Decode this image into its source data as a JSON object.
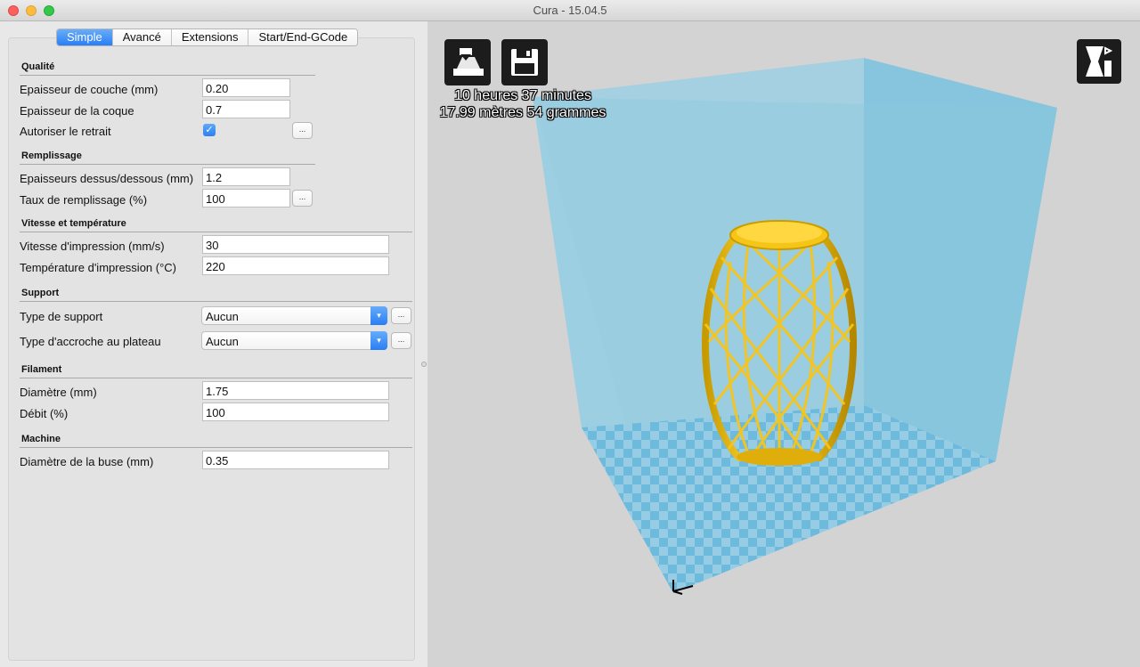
{
  "window": {
    "title": "Cura - 15.04.5"
  },
  "tabs": [
    {
      "label": "Simple",
      "active": true
    },
    {
      "label": "Avancé",
      "active": false
    },
    {
      "label": "Extensions",
      "active": false
    },
    {
      "label": "Start/End-GCode",
      "active": false
    }
  ],
  "sections": {
    "qualite": {
      "title": "Qualité",
      "layer_height": {
        "label": "Epaisseur de couche (mm)",
        "value": "0.20"
      },
      "shell_thickness": {
        "label": "Epaisseur de la coque",
        "value": "0.7"
      },
      "retraction": {
        "label": "Autoriser le retrait",
        "checked": true,
        "more": "..."
      }
    },
    "remplissage": {
      "title": "Remplissage",
      "top_bottom": {
        "label": "Epaisseurs dessus/dessous (mm)",
        "value": "1.2"
      },
      "fill_density": {
        "label": "Taux de remplissage (%)",
        "value": "100",
        "more": "..."
      }
    },
    "vitesse": {
      "title": "Vitesse et température",
      "print_speed": {
        "label": "Vitesse d'impression (mm/s)",
        "value": "30"
      },
      "print_temp": {
        "label": "Température d'impression (°C)",
        "value": "220"
      }
    },
    "support": {
      "title": "Support",
      "support_type": {
        "label": "Type de support",
        "value": "Aucun",
        "more": "..."
      },
      "adhesion_type": {
        "label": "Type d'accroche au plateau",
        "value": "Aucun",
        "more": "..."
      }
    },
    "filament": {
      "title": "Filament",
      "diameter": {
        "label": "Diamètre (mm)",
        "value": "1.75"
      },
      "flow": {
        "label": "Débit (%)",
        "value": "100"
      }
    },
    "machine": {
      "title": "Machine",
      "nozzle": {
        "label": "Diamètre de la buse (mm)",
        "value": "0.35"
      }
    }
  },
  "viewport": {
    "print_time": "10 heures 37 minutes",
    "material": "17.99 mètres 54 grammes",
    "icons": [
      "load-model-icon",
      "save-gcode-icon",
      "view-mode-icon"
    ],
    "colors": {
      "build_volume": "#7fc3dd",
      "plate_light": "#9cd0e6",
      "plate_dark": "#5eb3da",
      "model": "#f7c51c",
      "background": "#d3d3d3"
    }
  }
}
